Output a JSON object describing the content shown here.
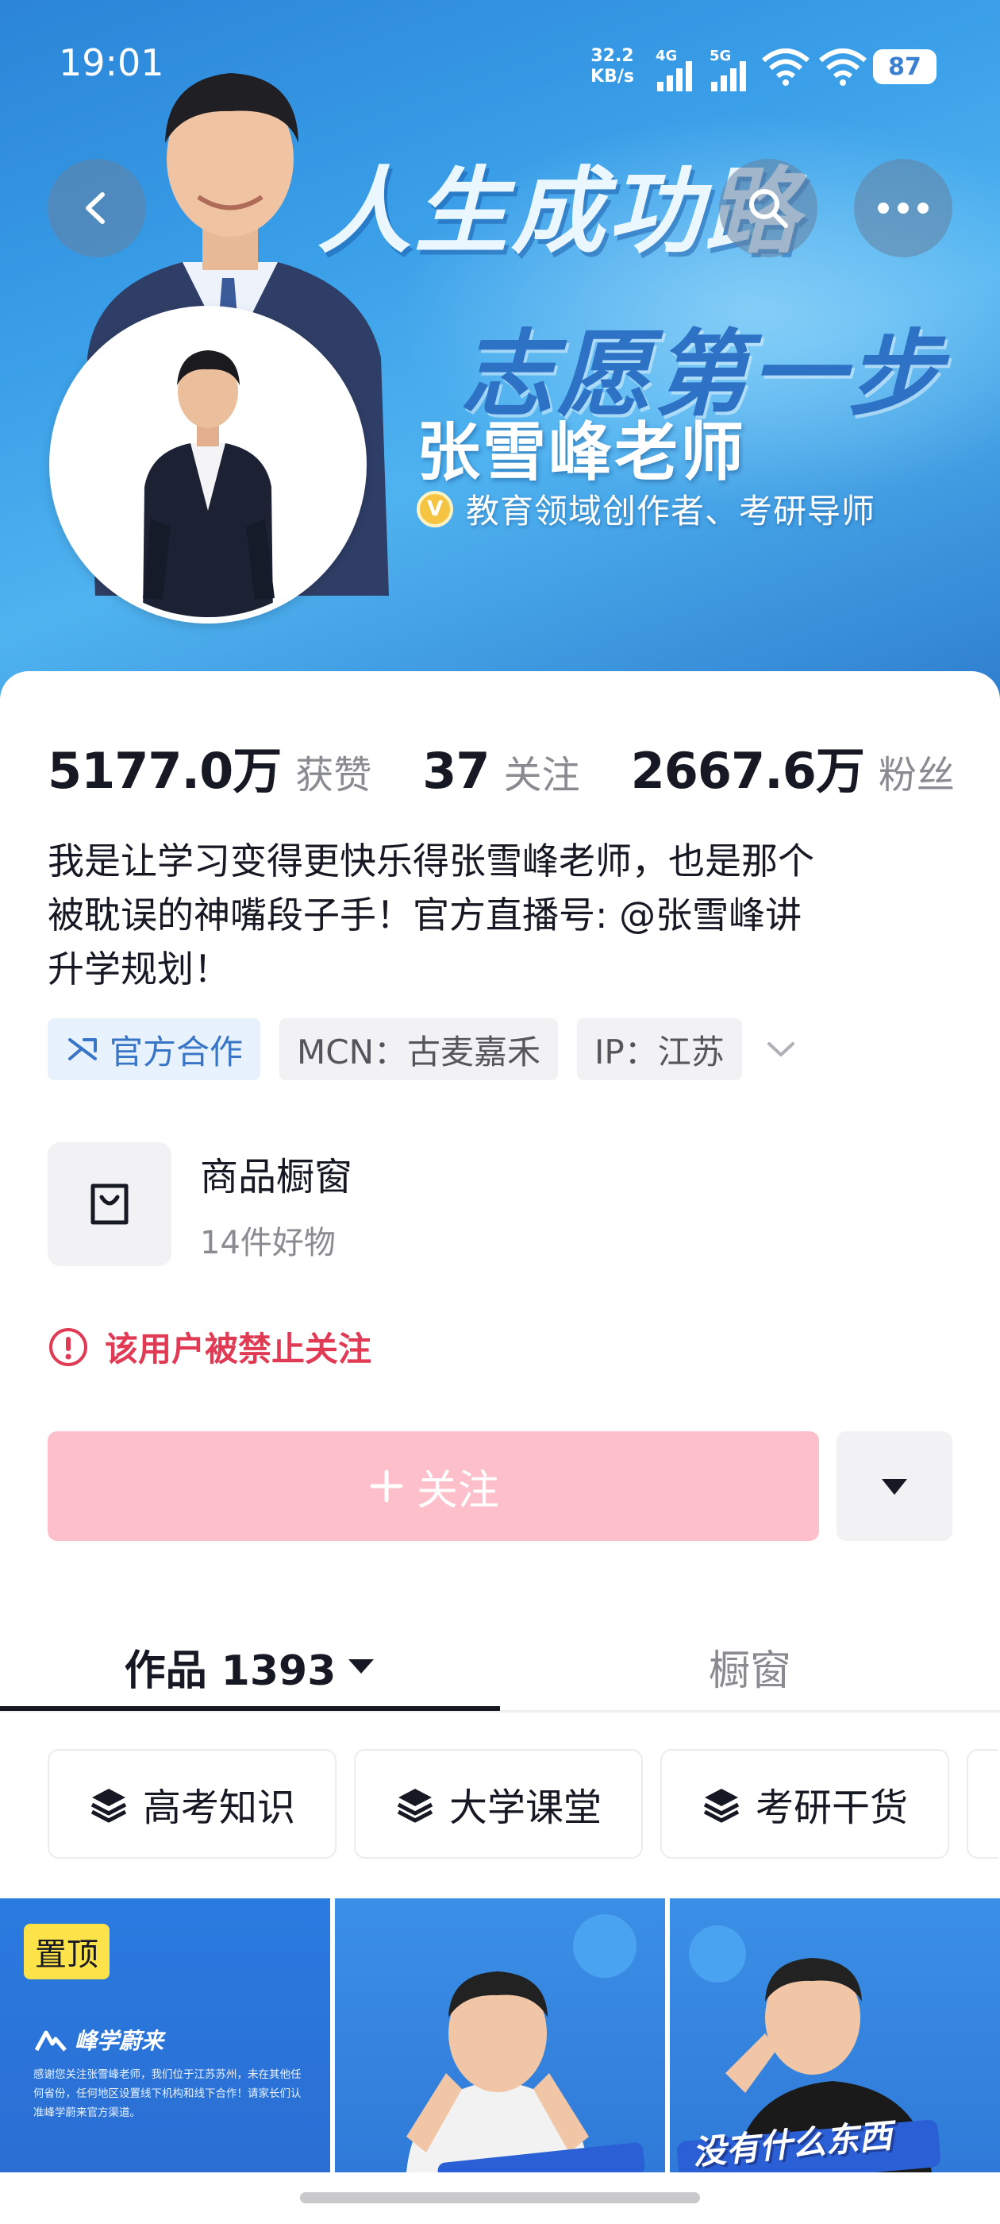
{
  "status_bar": {
    "time": "19:01",
    "net_speed_value": "32.2",
    "net_speed_unit": "KB/s",
    "signal1": "4G",
    "signal2": "5G",
    "battery": "87"
  },
  "banner": {
    "slogan_line1": "人生成功路",
    "slogan_line2": "志愿第一步",
    "name": "张雪峰老师",
    "verified_badge": "V",
    "verified_text": "教育领域创作者、考研导师"
  },
  "stats": [
    {
      "value": "5177.0万",
      "label": "获赞"
    },
    {
      "value": "37",
      "label": "关注"
    },
    {
      "value": "2667.6万",
      "label": "粉丝"
    }
  ],
  "bio": {
    "line1": "我是让学习变得更快乐得张雪峰老师，也是那个",
    "line2": "被耽误的神嘴段子手！官方直播号: @张雪峰讲",
    "line3": "升学规划！"
  },
  "tags": {
    "official": "官方合作",
    "mcn": "MCN：古麦嘉禾",
    "ip": "IP：江苏"
  },
  "shop": {
    "title": "商品橱窗",
    "subtitle": "14件好物"
  },
  "warning": {
    "text": "该用户被禁止关注"
  },
  "follow": {
    "label": "关注"
  },
  "tabs": {
    "works": "作品 1393",
    "showcase": "橱窗"
  },
  "collections": [
    "高考知识",
    "大学课堂",
    "考研干货"
  ],
  "thumbnails": {
    "pinned_label": "置顶",
    "brand": "峰学蔚来",
    "notice": "感谢您关注张雪峰老师，我们位于江苏苏州，未在其他任何省份，任何地区设置线下机构和线下合作！请家长们认准峰学蔚来官方渠道。",
    "caption3": "没有什么东西"
  },
  "colors": {
    "follow_button": "#fdbfca",
    "warning": "#e03a55",
    "official_tag": "#3875c6",
    "pin_badge": "#fde34a",
    "banner_blue": "#3a9fe8"
  }
}
